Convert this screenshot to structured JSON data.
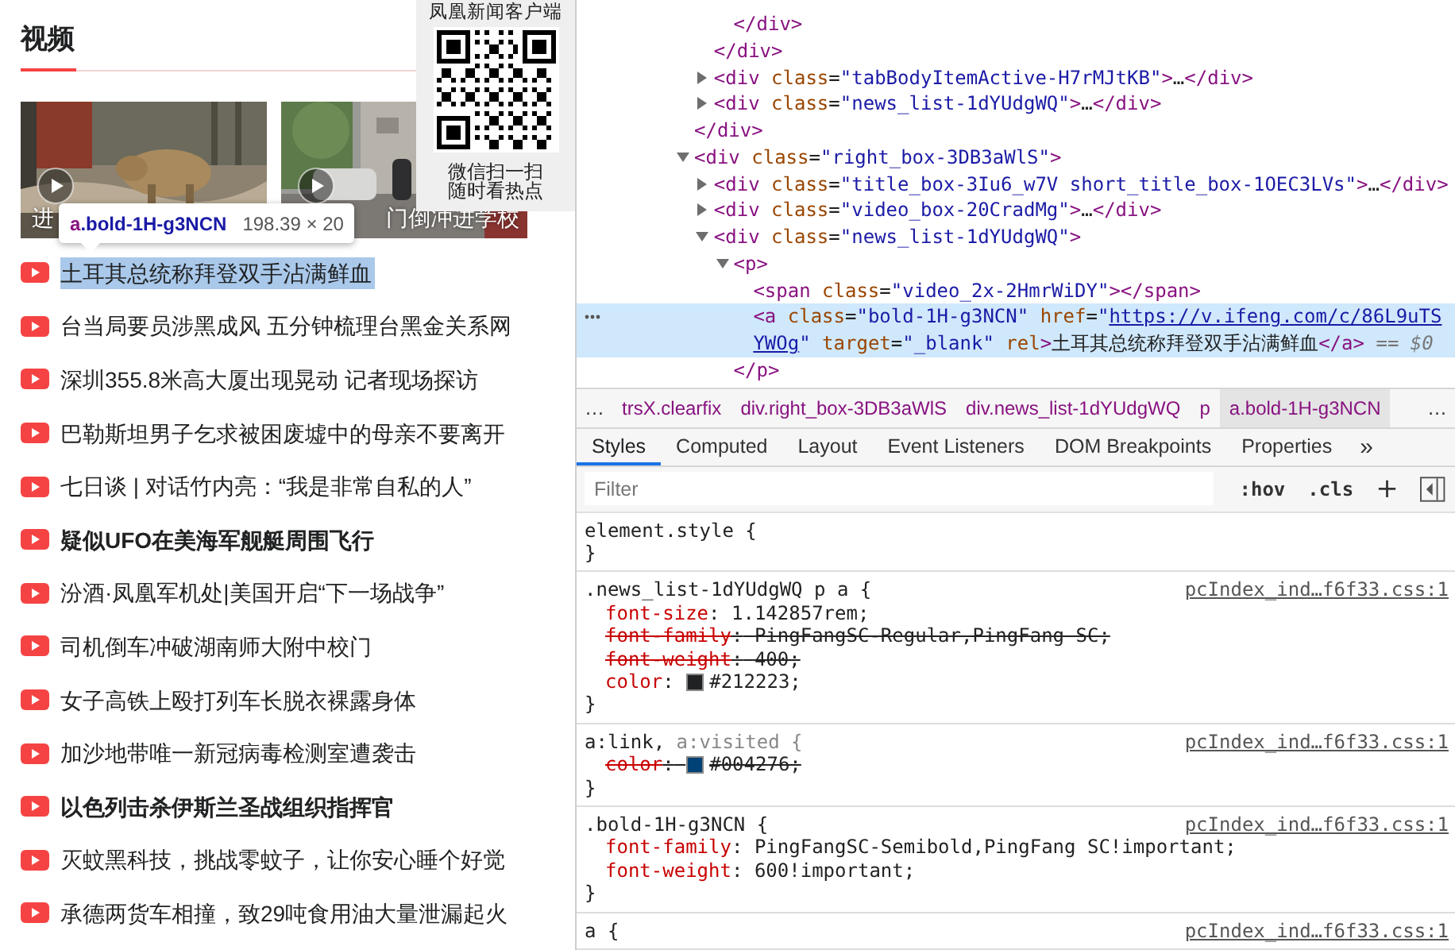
{
  "news_page": {
    "section_title": "视频",
    "videos": [
      {
        "kind": "picture",
        "caption": "进"
      },
      {
        "kind": "picture",
        "caption": "门倒冲进学校"
      }
    ],
    "qr_popup": {
      "title": "凤凰新闻客户端",
      "lines": [
        "微信扫一扫",
        "随时看热点"
      ]
    },
    "inspect_tooltip": {
      "element": "a.bold-1H-g3NCN",
      "size": "198.39 × 20"
    },
    "news": [
      {
        "title": "土耳其总统称拜登双手沾满鲜血",
        "bold": false,
        "highlighted": true
      },
      {
        "title": "台当局要员涉黑成风 五分钟梳理台黑金关系网",
        "bold": false,
        "highlighted": false
      },
      {
        "title": "深圳355.8米高大厦出现晃动 记者现场探访",
        "bold": false,
        "highlighted": false
      },
      {
        "title": "巴勒斯坦男子乞求被困废墟中的母亲不要离开",
        "bold": false,
        "highlighted": false
      },
      {
        "title": "七日谈 | 对话竹内亮：“我是非常自私的人”",
        "bold": false,
        "highlighted": false
      },
      {
        "title": "疑似UFO在美海军舰艇周围飞行",
        "bold": true,
        "highlighted": false
      },
      {
        "title": "汾酒·凤凰军机处|美国开启“下一场战争”",
        "bold": false,
        "highlighted": false
      },
      {
        "title": "司机倒车冲破湖南师大附中校门",
        "bold": false,
        "highlighted": false
      },
      {
        "title": "女子高铁上殴打列车长脱衣裸露身体",
        "bold": false,
        "highlighted": false
      },
      {
        "title": "加沙地带唯一新冠病毒检测室遭袭击",
        "bold": false,
        "highlighted": false
      },
      {
        "title": "以色列击杀伊斯兰圣战组织指挥官",
        "bold": true,
        "highlighted": false
      },
      {
        "title": "灭蚊黑科技，挑战零蚊子，让你安心睡个好觉",
        "bold": false,
        "highlighted": false
      },
      {
        "title": "承德两货车相撞，致29吨食用油大量泄漏起火",
        "bold": false,
        "highlighted": false
      }
    ]
  },
  "devtools": {
    "dom_tree": [
      {
        "children": [
          {
            "children": [
              {
                "close": "</div>"
              }
            ],
            "close": "</div>"
          },
          {
            "open": "<div class=\"tabBodyItemActive-H7rMJtKB\">…</div>",
            "expanded": false,
            "selected": false
          },
          {
            "open": "<div class=\"news_list-1dYUdgWQ\">…</div>",
            "expanded": false,
            "selected": false
          }
        ],
        "close": "</div>"
      },
      {
        "open": "<div class=\"right_box-3DB3aWlS\">",
        "expanded": true,
        "selected": false,
        "children": [
          {
            "open": "<div class=\"title_box-3Iu6_w7V short_title_box-1OEC3LVs\">…</div>",
            "expanded": false,
            "selected": false
          },
          {
            "open": "<div class=\"video_box-20CradMg\">…</div>",
            "expanded": false,
            "selected": false
          },
          {
            "open": "<div class=\"news_list-1dYUdgWQ\">",
            "expanded": true,
            "selected": false,
            "children": [
              {
                "open": "<p>",
                "expanded": true,
                "selected": false,
                "children": [
                  {
                    "open": "<span class=\"video_2x-2HmrWiDY\"></span>",
                    "selected": false
                  },
                  {
                    "open": "<a class=\"bold-1H-g3NCN\" href=\"https://v.ifeng.com/c/86L9uTSYWOg\" target=\"_blank\" rel>土耳其总统称拜登双手沾满鲜血</a>",
                    "console_ref": "== $0",
                    "selected": true
                  }
                ],
                "close": "</p>"
              }
            ]
          }
        ]
      }
    ],
    "breadcrumb_scroll": [
      "…",
      "…"
    ],
    "breadcrumbs": [
      {
        "text": "trsX.clearfix",
        "selected": false
      },
      {
        "text": "div.right_box-3DB3aWlS",
        "selected": false
      },
      {
        "text": "div.news_list-1dYUdgWQ",
        "selected": false
      },
      {
        "text": "p",
        "selected": false
      },
      {
        "text": "a.bold-1H-g3NCN",
        "selected": true
      }
    ],
    "tabs": [
      {
        "label": "Styles",
        "selected": true
      },
      {
        "label": "Computed",
        "selected": false
      },
      {
        "label": "Layout",
        "selected": false
      },
      {
        "label": "Event Listeners",
        "selected": false
      },
      {
        "label": "DOM Breakpoints",
        "selected": false
      },
      {
        "label": "Properties",
        "selected": false
      }
    ],
    "more_tabs": "»",
    "filter": {
      "placeholder": "Filter"
    },
    "filter_buttons": [
      ":hov",
      ".cls",
      "+"
    ],
    "rules": [
      {
        "selector": [
          {
            "text": "element.style {",
            "matched": true
          }
        ],
        "close": "}"
      },
      {
        "selector": [
          {
            "text": ".news_list-1dYUdgWQ p a {",
            "matched": true
          }
        ],
        "source": "pcIndex_ind…f6f33.css:1",
        "declarations": [
          {
            "property": "font-size:",
            "value": "1.142857rem;",
            "overridden": false
          },
          {
            "property": "font-family:",
            "value": "PingFangSC-Regular,PingFang SC;",
            "overridden": true
          },
          {
            "property": "font-weight:",
            "value": "400;",
            "overridden": true
          },
          {
            "property": "color:",
            "swatch": true,
            "value": "#212223;",
            "overridden": false
          }
        ],
        "close": "}"
      },
      {
        "selector": [
          {
            "text": "a:link,",
            "matched": true
          },
          {
            "text": "a:visited {",
            "matched": false
          }
        ],
        "source": "pcIndex_ind…f6f33.css:1",
        "declarations": [
          {
            "property": "color:",
            "swatch": true,
            "value": "#004276;",
            "overridden": true
          }
        ],
        "close": "}"
      },
      {
        "selector": [
          {
            "text": ".bold-1H-g3NCN {",
            "matched": true
          }
        ],
        "source": "pcIndex_ind…f6f33.css:1",
        "declarations": [
          {
            "property": "font-family:",
            "value": "PingFangSC-Semibold,PingFang SC!important;",
            "overridden": false
          },
          {
            "property": "font-weight:",
            "value": "600!important;",
            "overridden": false
          }
        ],
        "close": "}"
      },
      {
        "selector": [
          {
            "text": "a {",
            "matched": true
          }
        ],
        "source": "pcIndex_ind…f6f33.css:1"
      }
    ]
  }
}
